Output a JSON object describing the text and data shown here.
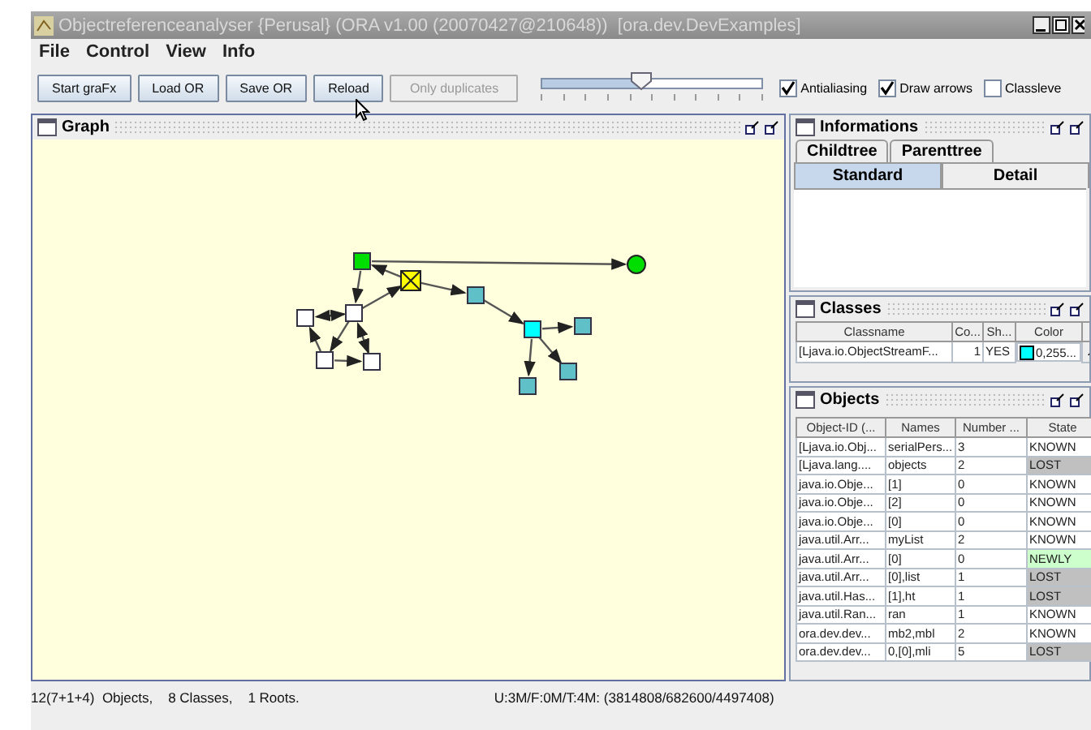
{
  "window": {
    "title": "Objectreferenceanalyser {Perusal} (ORA v1.00 (20070427@210648))  [ora.dev.DevExamples]"
  },
  "menu": [
    "File",
    "Control",
    "View",
    "Info"
  ],
  "toolbar": {
    "buttons": [
      {
        "label": "Start graFx",
        "disabled": false
      },
      {
        "label": "Load OR",
        "disabled": false
      },
      {
        "label": "Save OR",
        "disabled": false
      },
      {
        "label": "Reload",
        "disabled": false
      },
      {
        "label": "Only duplicates",
        "disabled": true
      }
    ],
    "slider": {
      "level": 0.45
    },
    "checkboxes": [
      {
        "label": "Antialiasing",
        "checked": true
      },
      {
        "label": "Draw arrows",
        "checked": true
      },
      {
        "label": "Classleve",
        "checked": false
      }
    ]
  },
  "graph_panel": {
    "title": "Graph"
  },
  "info_panel": {
    "title": "Informations",
    "upper_tabs": [
      {
        "label": "Childtree",
        "selected": false
      },
      {
        "label": "Parenttree",
        "selected": false
      }
    ],
    "tabs": [
      {
        "label": "Standard",
        "selected": true
      },
      {
        "label": "Detail",
        "selected": false
      }
    ]
  },
  "classes_panel": {
    "title": "Classes",
    "columns": [
      "Classname",
      "Co...",
      "Sh...",
      "Color"
    ],
    "rows": [
      {
        "classname": "[Ljava.io.ObjectStreamF...",
        "count": "1",
        "shown": "YES",
        "color": "#00ffff",
        "color_text": "0,255..."
      }
    ]
  },
  "objects_panel": {
    "title": "Objects",
    "columns": [
      "Object-ID (...",
      "Names",
      "Number ...",
      "State"
    ],
    "rows": [
      {
        "cells": [
          "[Ljava.io.Obj...",
          "serialPers...",
          "3",
          "KNOWN"
        ],
        "color": "#ffffff"
      },
      {
        "cells": [
          "[Ljava.lang....",
          "objects",
          "2",
          "LOST"
        ],
        "color": "#c0c0c0"
      },
      {
        "cells": [
          "java.io.Obje...",
          "[1]",
          "0",
          "KNOWN"
        ],
        "color": "#ffffff"
      },
      {
        "cells": [
          "java.io.Obje...",
          "[2]",
          "0",
          "KNOWN"
        ],
        "color": "#ffffff"
      },
      {
        "cells": [
          "java.io.Obje...",
          "[0]",
          "0",
          "KNOWN"
        ],
        "color": "#ffffff"
      },
      {
        "cells": [
          "java.util.Arr...",
          "myList",
          "2",
          "KNOWN"
        ],
        "color": "#ffffff"
      },
      {
        "cells": [
          "java.util.Arr...",
          "[0]",
          "0",
          "NEWLY"
        ],
        "color": "#ccffcc"
      },
      {
        "cells": [
          "java.util.Arr...",
          "[0],list",
          "1",
          "LOST"
        ],
        "color": "#c0c0c0"
      },
      {
        "cells": [
          "java.util.Has...",
          "[1],ht",
          "1",
          "LOST"
        ],
        "color": "#c0c0c0"
      },
      {
        "cells": [
          "java.util.Ran...",
          "ran",
          "1",
          "KNOWN"
        ],
        "color": "#ffffff"
      },
      {
        "cells": [
          "ora.dev.dev...",
          "mb2,mbl",
          "2",
          "KNOWN"
        ],
        "color": "#ffffff"
      },
      {
        "cells": [
          "ora.dev.dev...",
          "0,[0],mli",
          "5",
          "LOST"
        ],
        "color": "#c0c0c0"
      }
    ]
  },
  "status_bar": {
    "left": "12(7+1+4)  Objects,    8 Classes,    1 Roots.",
    "right": "U:3M/F:0M/T:4M: (3814808/682600/4497408)"
  }
}
